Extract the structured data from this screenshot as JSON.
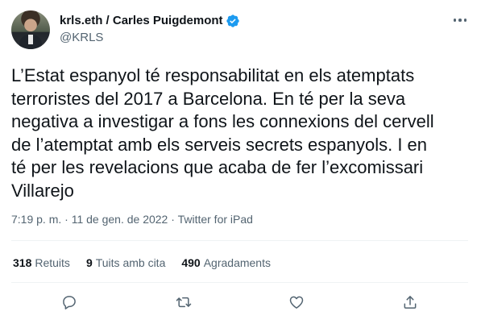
{
  "author": {
    "display_name": "krls.eth / Carles Puigdemont",
    "handle": "@KRLS",
    "verified": true
  },
  "tweet": {
    "lines": [
      "L’Estat espanyol té responsabilitat en els atemptats",
      "terroristes del 2017 a Barcelona. En té per la seva",
      "negativa a investigar a fons les connexions del cervell",
      "de l’atemptat amb els serveis secrets espanyols. I en",
      "té per les revelacions que acaba de fer l’excomissari",
      "Villarejo"
    ]
  },
  "meta": {
    "time": "7:19 p. m.",
    "separator1": " · ",
    "date": "11 de gen. de 2022",
    "separator2": " · ",
    "source": "Twitter for iPad"
  },
  "stats": {
    "retweets_count": "318",
    "retweets_label": "Retuits",
    "quotes_count": "9",
    "quotes_label": "Tuits amb cita",
    "likes_count": "490",
    "likes_label": "Agradaments"
  },
  "colors": {
    "text": "#0f1419",
    "secondary": "#536471",
    "verified": "#1d9bf0",
    "divider": "#eff3f4"
  },
  "icons": {
    "reply": "speech-bubble-icon",
    "retweet": "retweet-arrows-icon",
    "like": "heart-icon",
    "share": "share-upload-icon",
    "more": "more-dots-icon"
  }
}
